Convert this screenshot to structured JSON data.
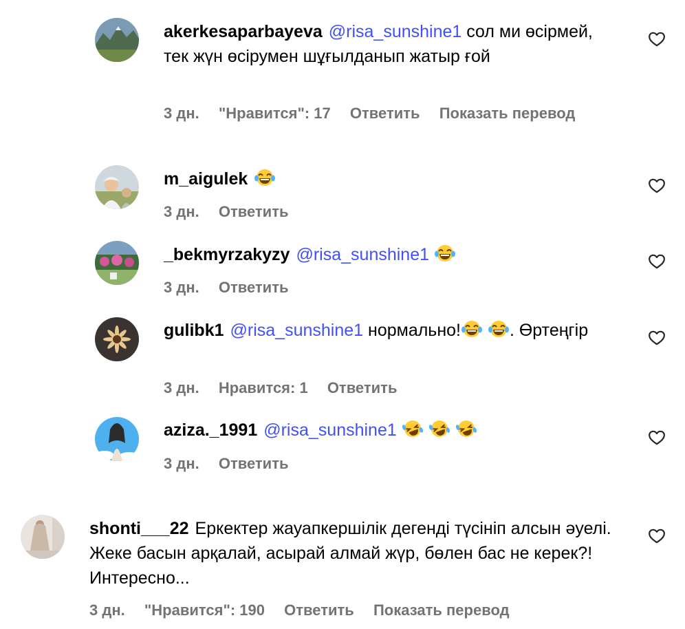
{
  "colors": {
    "mention": "#4150f7",
    "meta": "#737373",
    "text": "#000000"
  },
  "comments": [
    {
      "username": "akerkesaparbayeva",
      "mention": "@risa_sunshine1",
      "text": "сол ми өсірмей, тек жүн өсірумен шұғылданып жатыр ғой",
      "time": "3 дн.",
      "likes": "\"Нравится\": 17",
      "reply": "Ответить",
      "translate": "Показать перевод",
      "avatar_icon": "avatar-mountains",
      "like_icon": "heart-outline-icon"
    },
    {
      "username": "m_aigulek",
      "emojis": [
        "laughing-crying-emoji"
      ],
      "time": "3 дн.",
      "reply": "Ответить",
      "avatar_icon": "avatar-person-outdoors",
      "like_icon": "heart-outline-icon"
    },
    {
      "username": "_bekmyrzakyzy",
      "mention": "@risa_sunshine1",
      "emojis": [
        "laughing-crying-emoji"
      ],
      "time": "3 дн.",
      "reply": "Ответить",
      "avatar_icon": "avatar-garden",
      "like_icon": "heart-outline-icon"
    },
    {
      "username": "gulibk1",
      "mention": "@risa_sunshine1",
      "text_before": "нормально!",
      "emojis": [
        "laughing-crying-emoji",
        "laughing-crying-emoji"
      ],
      "text_after": ". Өртеңгір",
      "time": "3 дн.",
      "likes": "Нравится: 1",
      "reply": "Ответить",
      "avatar_icon": "avatar-flower",
      "like_icon": "heart-outline-icon"
    },
    {
      "username": "aziza._1991",
      "mention": "@risa_sunshine1",
      "emojis": [
        "rolling-laughing-emoji",
        "rolling-laughing-emoji",
        "rolling-laughing-emoji"
      ],
      "time": "3 дн.",
      "reply": "Ответить",
      "avatar_icon": "avatar-sky-person",
      "like_icon": "heart-outline-icon"
    },
    {
      "username": "shonti___22",
      "text": "Еркектер жауапкершілік дегенді түсініп алсын әуелі. Жеке басын арқалай, асырай алмай жүр, бөлен бас не керек?! Интересно...",
      "time": "3 дн.",
      "likes": "\"Нравится\": 190",
      "reply": "Ответить",
      "translate": "Показать перевод",
      "avatar_icon": "avatar-woman-dress",
      "like_icon": "heart-outline-icon"
    }
  ]
}
